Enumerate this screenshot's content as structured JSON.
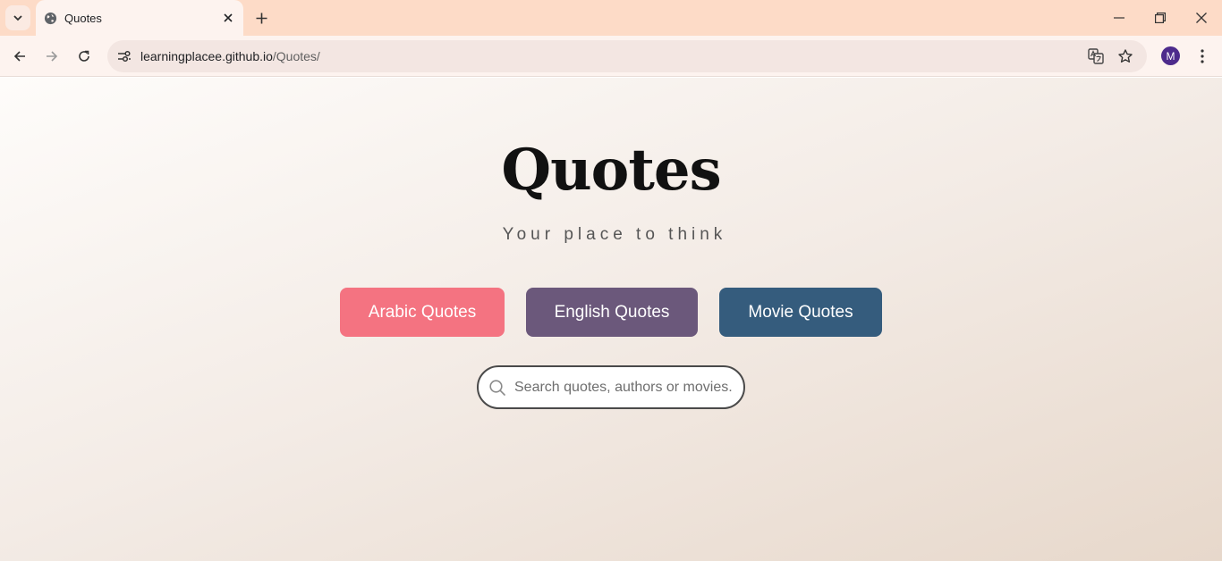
{
  "browser": {
    "tab": {
      "title": "Quotes"
    },
    "address": {
      "domain": "learningplacee.github.io",
      "path": "/Quotes/"
    },
    "profile_initial": "M"
  },
  "page": {
    "title": "Quotes",
    "subtitle": "Your place to think",
    "buttons": {
      "arabic": "Arabic Quotes",
      "english": "English Quotes",
      "movie": "Movie Quotes"
    },
    "search": {
      "placeholder": "Search quotes, authors or movies.",
      "value": ""
    }
  },
  "colors": {
    "tabstrip": "#fddbc7",
    "arabic_button": "#f47381",
    "english_button": "#6b587b",
    "movie_button": "#355c7d",
    "avatar": "#4d2b8c"
  },
  "icons": [
    "tab-search-icon",
    "globe-icon",
    "close-icon",
    "plus-icon",
    "minimize-icon",
    "restore-icon",
    "back-icon",
    "forward-icon",
    "reload-icon",
    "site-info-icon",
    "translate-icon",
    "star-icon",
    "kebab-menu-icon",
    "search-icon"
  ]
}
